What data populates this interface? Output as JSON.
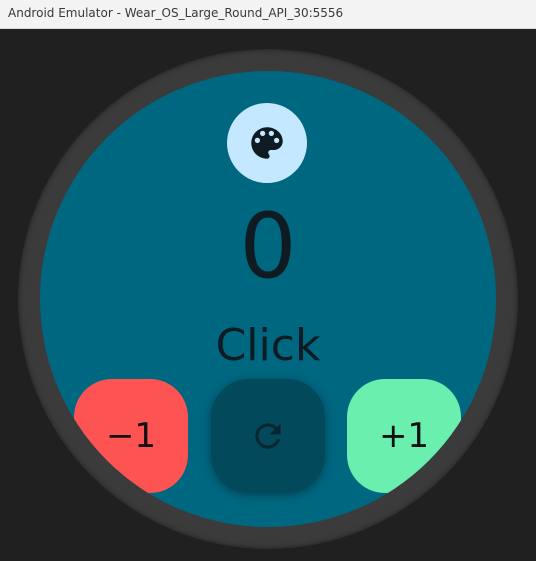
{
  "window": {
    "title": "Android Emulator - Wear_OS_Large_Round_API_30:5556"
  },
  "app": {
    "counter_value": "0",
    "label": "Click",
    "palette_icon": "palette-icon",
    "buttons": {
      "decrement_label": "−1",
      "reset_icon": "refresh-icon",
      "increment_label": "+1"
    }
  },
  "colors": {
    "screen_background": "#006781",
    "palette_button": "#c4e8ff",
    "decrement_button": "#fe5353",
    "reset_button": "#02495c",
    "increment_button": "#6aefaf",
    "bezel": "#3b3b3b",
    "desktop": "#202020"
  }
}
